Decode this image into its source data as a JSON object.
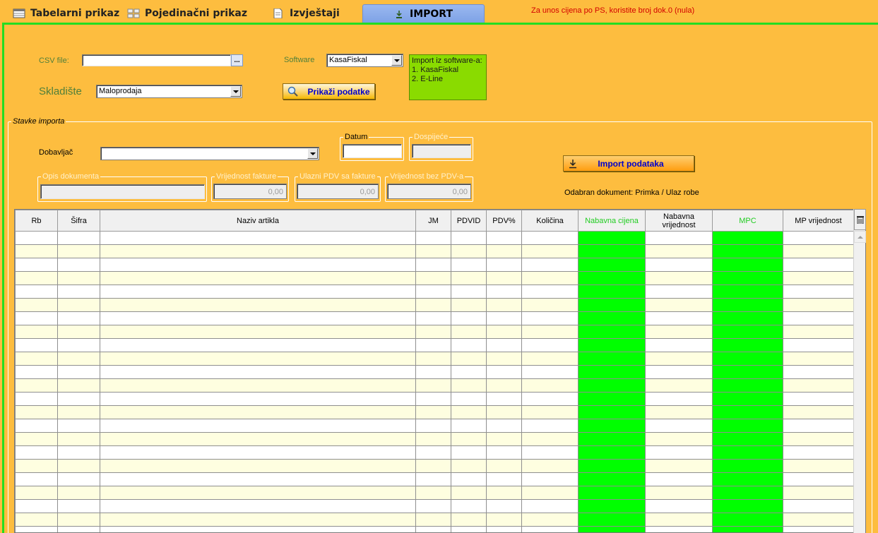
{
  "tabs": [
    {
      "label": "Tabelarni prikaz",
      "icon": "table-icon"
    },
    {
      "label": "Pojedinačni prikaz",
      "icon": "card-icon"
    },
    {
      "label": "Izvještaji",
      "icon": "document-icon"
    },
    {
      "label": "IMPORT",
      "icon": "download-icon",
      "active": true
    }
  ],
  "top_note": "Za unos cijena po PS, koristite broj dok.0 (nula)",
  "form": {
    "csv_label": "CSV file:",
    "csv_value": "",
    "browse_label": "...",
    "software_label": "Software",
    "software_value": "KasaFiskal",
    "skladiste_label": "Skladište",
    "skladiste_value": "Maloprodaja",
    "show_button": "Prikaži podatke",
    "info_lines": [
      "Import iz software-a:",
      "1. KasaFiskal",
      "2. E-Line"
    ]
  },
  "stavke": {
    "group_label": "Stavke importa",
    "dobavljac_label": "Dobavljač",
    "dobavljac_value": "",
    "datum_label": "Datum",
    "datum_value": "",
    "dospijece_label": "Dospijeće",
    "opis_label": "Opis dokumenta",
    "vrijednost_label": "Vrijednost fakture",
    "vrijednost_value": "0,00",
    "ulazni_pdv_label": "Ulazni PDV sa fakture",
    "ulazni_pdv_value": "0,00",
    "bez_pdv_label": "Vrijednost bez PDV-a",
    "bez_pdv_value": "0,00",
    "import_button": "Import podataka",
    "odabran": "Odabran dokument: Primka / Ulaz robe"
  },
  "table": {
    "columns": [
      "Rb",
      "Šifra",
      "Naziv artikla",
      "JM",
      "PDVID",
      "PDV%",
      "Količina",
      "Nabavna cijena",
      "Nabavna vrijednost",
      "MPC",
      "MP vrijednost"
    ],
    "green_columns": [
      7,
      9
    ],
    "row_count": 23
  },
  "colors": {
    "background": "#fdbd3f",
    "highlight_column": "#00ff00",
    "panel_border": "#22dd22",
    "note_red": "#d30000"
  }
}
